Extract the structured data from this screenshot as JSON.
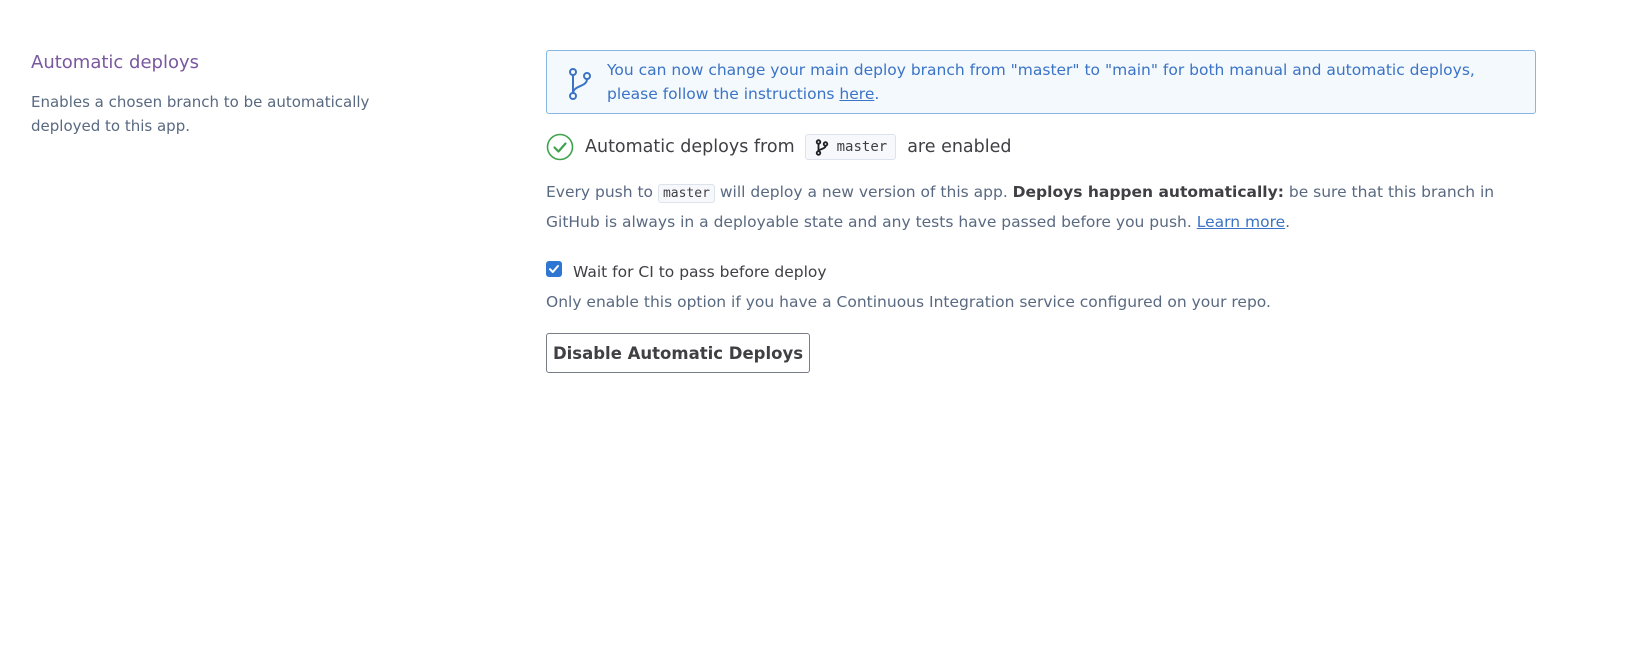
{
  "section": {
    "title": "Automatic deploys",
    "description": "Enables a chosen branch to be automatically deployed to this app."
  },
  "info_banner": {
    "icon": "git-branch-icon",
    "text": "You can now change your main deploy branch from \"master\" to \"main\" for both manual and automatic deploys, please follow the instructions ",
    "link_text": "here",
    "suffix": ".",
    "color": "#3b73c6"
  },
  "status": {
    "icon": "check-circle-icon",
    "prefix": "Automatic deploys from",
    "branch": "master",
    "suffix": "are enabled",
    "color": "#3fa34d"
  },
  "description": {
    "part1": "Every push to ",
    "branch": "master",
    "part2": " will deploy a new version of this app. ",
    "bold": "Deploys happen automatically:",
    "part3": " be sure that this branch in GitHub is always in a deployable state and any tests have passed before you push. ",
    "link_text": "Learn more",
    "end": "."
  },
  "ci_option": {
    "label": "Wait for CI to pass before deploy",
    "checked": true,
    "help": "Only enable this option if you have a Continuous Integration service configured on your repo."
  },
  "disable_button": {
    "label": "Disable Automatic Deploys"
  }
}
